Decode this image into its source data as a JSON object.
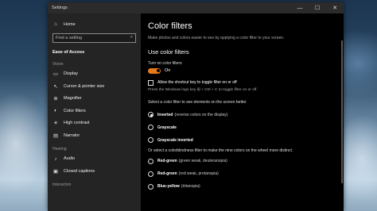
{
  "window": {
    "title": "Settings"
  },
  "sidebar": {
    "home": "Home",
    "search_placeholder": "Find a setting",
    "category": "Ease of Access",
    "groups": [
      {
        "label": "Vision",
        "items": [
          "Display",
          "Cursor & pointer size",
          "Magnifier",
          "Color filters",
          "High contrast",
          "Narrator"
        ]
      },
      {
        "label": "Hearing",
        "items": [
          "Audio",
          "Closed captions"
        ]
      },
      {
        "label": "Interaction",
        "items": []
      }
    ],
    "active_item": "Color filters"
  },
  "main": {
    "title": "Color filters",
    "description": "Make photos and colors easier to see by applying a color filter to your screen.",
    "section_title": "Use color filters",
    "toggle_label": "Turn on color filters",
    "toggle_state": "On",
    "shortcut_label": "Allow the shortcut key to toggle filter on or off",
    "shortcut_hint": "Press the Windows logo key ⊞ + Ctrl + C to toggle filter on or off.",
    "select_label": "Select a color filter to see elements on the screen better",
    "filters": [
      {
        "name": "Inverted",
        "sub": "(reverse colors on the display)",
        "selected": true
      },
      {
        "name": "Grayscale",
        "sub": "",
        "selected": false
      },
      {
        "name": "Grayscale inverted",
        "sub": "",
        "selected": false
      }
    ],
    "colorblind_label": "Or select a colorblindness filter to make the nine colors on the wheel more distinct.",
    "colorblind_filters": [
      {
        "name": "Red-green",
        "sub": "(green weak, deuteranopia)"
      },
      {
        "name": "Red-green",
        "sub": "(red weak, protanopia)"
      },
      {
        "name": "Blue-yellow",
        "sub": "(tritanopia)"
      }
    ]
  },
  "colors": {
    "accent": "#e7781c",
    "sidebar_bg": "#242424",
    "main_bg": "#000000"
  }
}
